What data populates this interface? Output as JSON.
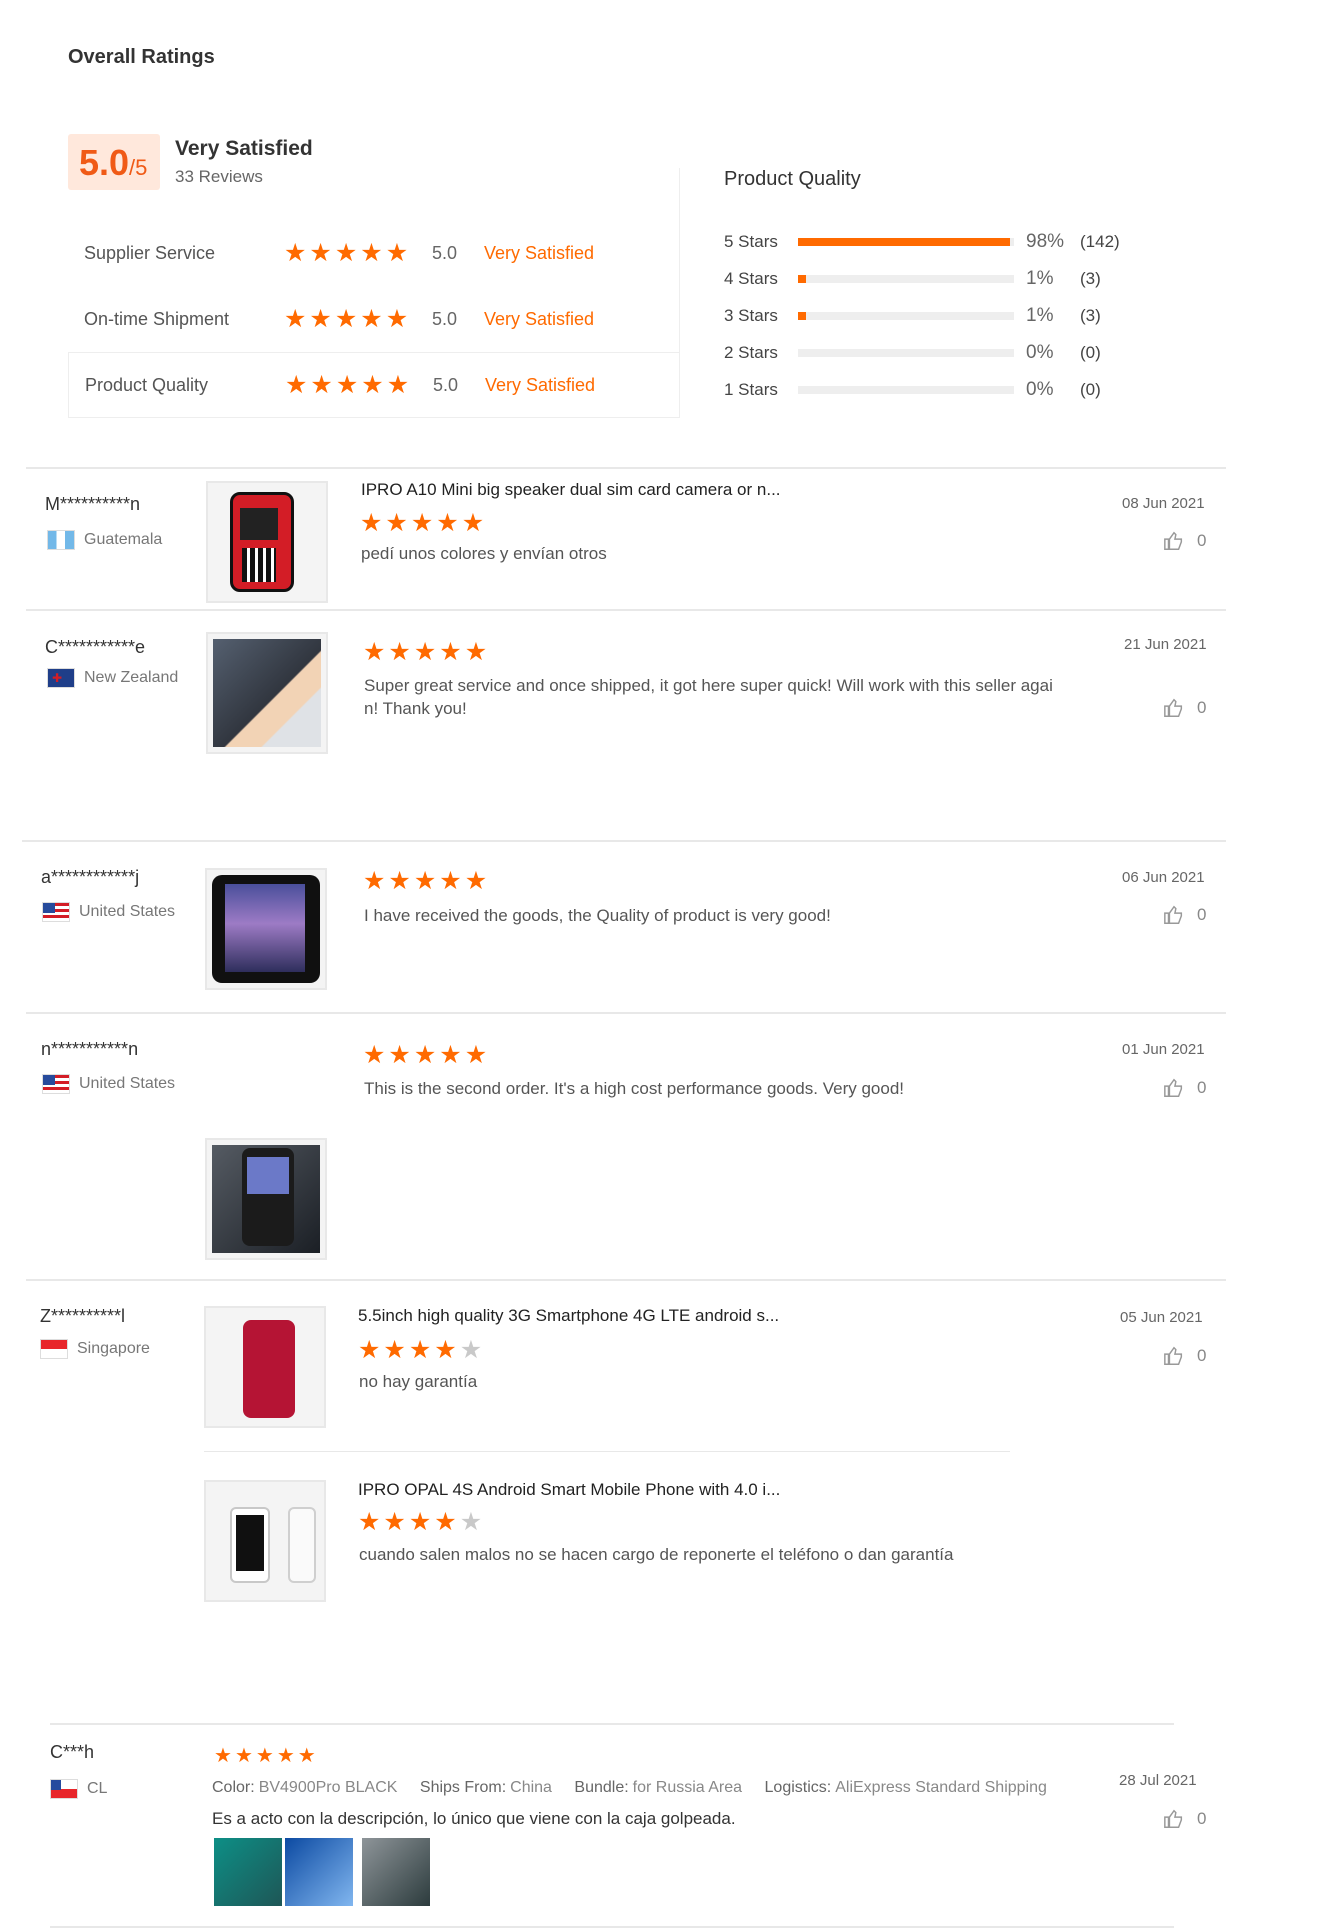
{
  "overall": {
    "title": "Overall Ratings",
    "score": "5.0",
    "score_suffix": "/5",
    "label": "Very Satisfied",
    "reviews": "33 Reviews"
  },
  "ratings": [
    {
      "name": "Supplier Service",
      "stars": 5,
      "score": "5.0",
      "label": "Very Satisfied"
    },
    {
      "name": "On-time Shipment",
      "stars": 5,
      "score": "5.0",
      "label": "Very Satisfied"
    },
    {
      "name": "Product Quality",
      "stars": 5,
      "score": "5.0",
      "label": "Very Satisfied"
    }
  ],
  "quality": {
    "title": "Product Quality",
    "bars": [
      {
        "label": "5 Stars",
        "fill": 0.98,
        "pct": "98%",
        "count": "(142)"
      },
      {
        "label": "4 Stars",
        "fill": 0.01,
        "pct": "1%",
        "count": "(3)"
      },
      {
        "label": "3 Stars",
        "fill": 0.01,
        "pct": "1%",
        "count": "(3)"
      },
      {
        "label": "2 Stars",
        "fill": 0,
        "pct": "0%",
        "count": "(0)"
      },
      {
        "label": "1 Stars",
        "fill": 0,
        "pct": "0%",
        "count": "(0)"
      }
    ]
  },
  "reviews": [
    {
      "name": "M**********n",
      "country": "Guatemala",
      "title": "IPRO A10 Mini big speaker dual sim card camera or n...",
      "stars": 5,
      "text": "pedí unos colores y envían otros",
      "date": "08 Jun 2021",
      "likes": "0"
    },
    {
      "name": "C***********e",
      "country": "New Zealand",
      "stars": 5,
      "text_lines": [
        "Super great service and once shipped, it got here super quick! Will work with this seller agai",
        "n! Thank you!"
      ],
      "date": "21 Jun 2021",
      "likes": "0"
    },
    {
      "name": "a************j",
      "country": "United States",
      "stars": 5,
      "text": "I have received the goods, the Quality of product is very good!",
      "date": "06 Jun 2021",
      "likes": "0"
    },
    {
      "name": "n***********n",
      "country": "United States",
      "stars": 5,
      "text": "This is the second order. It's a high cost performance goods. Very good!",
      "date": "01 Jun 2021",
      "likes": "0"
    },
    {
      "name": "Z**********l",
      "country": "Singapore",
      "title": "5.5inch high quality 3G Smartphone 4G LTE android s...",
      "stars": 4,
      "text": "no hay garantía",
      "date": "05 Jun 2021",
      "likes": "0",
      "second_title": "IPRO OPAL 4S Android Smart Mobile Phone with 4.0 i...",
      "second_stars": 4,
      "second_text": "cuando salen malos no se hacen cargo de reponerte el teléfono o dan garantía"
    },
    {
      "name": "C***h",
      "country": "CL",
      "stars": 5,
      "meta": {
        "color_label": "Color:",
        "color": "BV4900Pro BLACK",
        "ships_label": "Ships From:",
        "ships": "China",
        "bundle_label": "Bundle:",
        "bundle": "for Russia Area",
        "logistics_label": "Logistics:",
        "logistics": "AliExpress Standard Shipping"
      },
      "text": "Es a acto con la descripción, lo único que viene con la caja golpeada.",
      "date": "28 Jul 2021",
      "likes": "0"
    }
  ]
}
